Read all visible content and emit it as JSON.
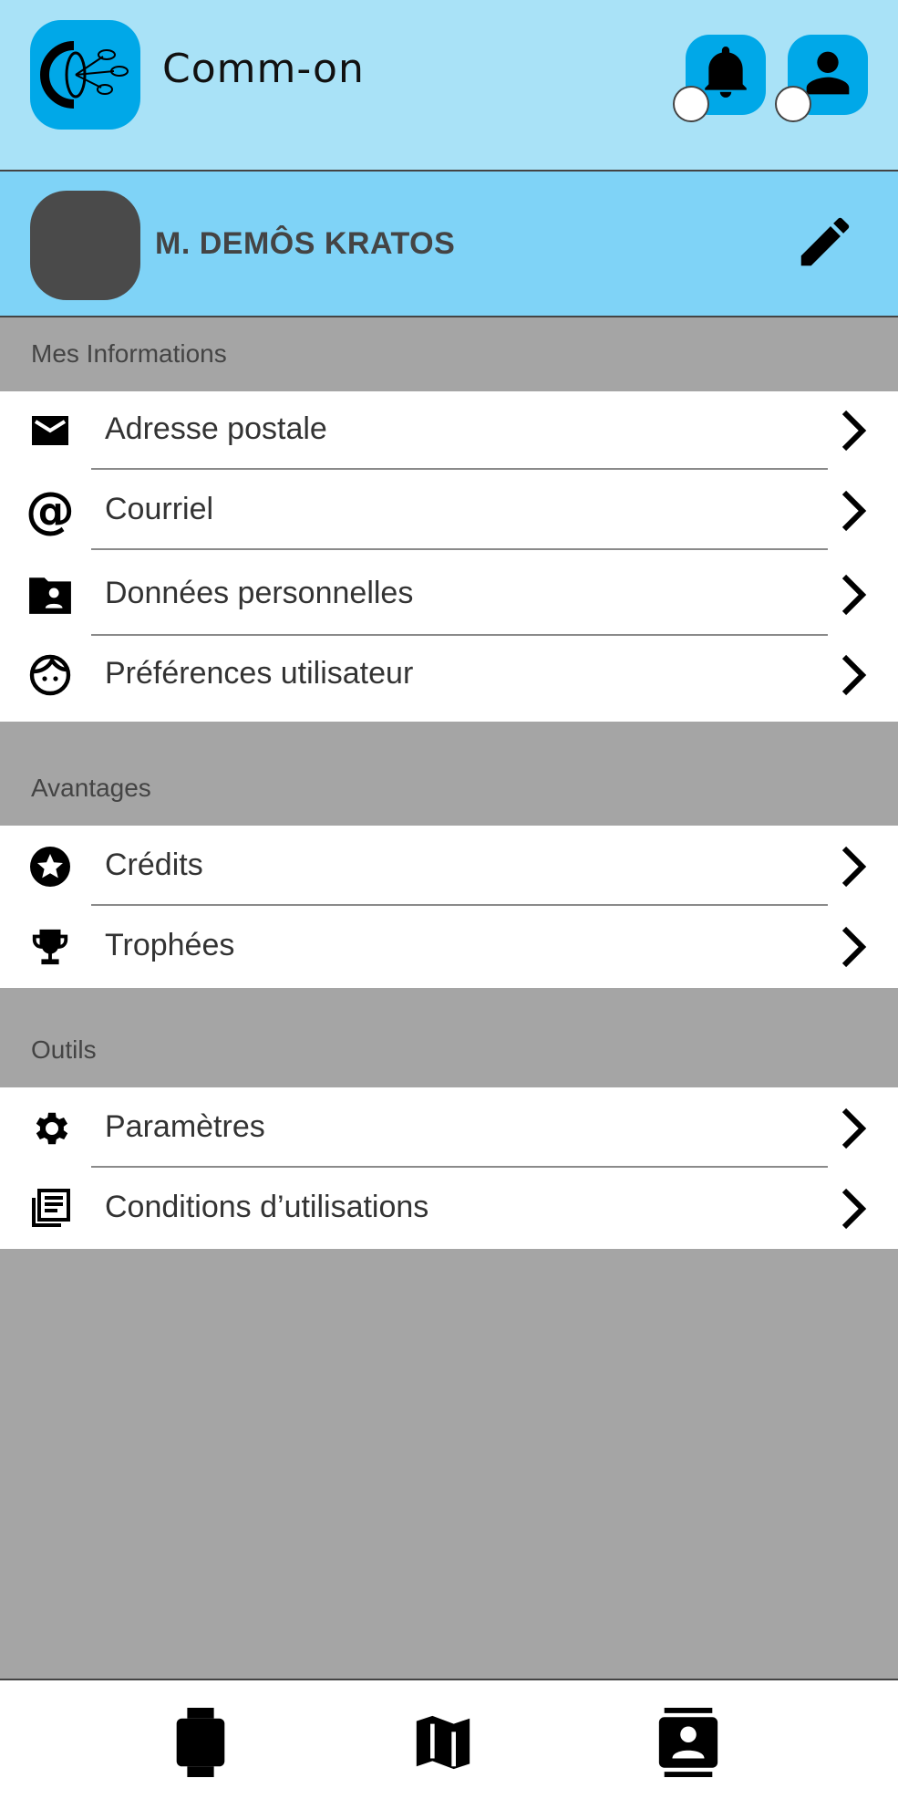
{
  "header": {
    "brand": "Comm-on",
    "icons": {
      "notifications": "bell-icon",
      "account": "person-icon"
    },
    "colors": {
      "background": "#a9e2f7",
      "accent": "#00a8e8"
    }
  },
  "profile": {
    "name": "M. DEMÔS KRATOS",
    "edit_icon": "pencil-icon",
    "background": "#7fd3f7"
  },
  "sections": {
    "info": {
      "title": "Mes Informations",
      "items": [
        {
          "label": "Adresse postale",
          "icon": "mail-icon"
        },
        {
          "label": "Courriel",
          "icon": "at-sign-icon"
        },
        {
          "label": "Données personnelles",
          "icon": "folder-user-icon"
        },
        {
          "label": "Préférences utilisateur",
          "icon": "face-icon"
        }
      ]
    },
    "benefits": {
      "title": "Avantages",
      "items": [
        {
          "label": "Crédits",
          "icon": "star-circle-icon"
        },
        {
          "label": "Trophées",
          "icon": "trophy-icon"
        }
      ]
    },
    "tools": {
      "title": "Outils",
      "items": [
        {
          "label": "Paramètres",
          "icon": "gear-icon"
        },
        {
          "label": "Conditions d’utilisations",
          "icon": "library-books-icon"
        }
      ]
    }
  },
  "bottom_nav": {
    "items": [
      {
        "icon": "watch-icon"
      },
      {
        "icon": "map-icon"
      },
      {
        "icon": "contact-card-icon"
      }
    ]
  }
}
